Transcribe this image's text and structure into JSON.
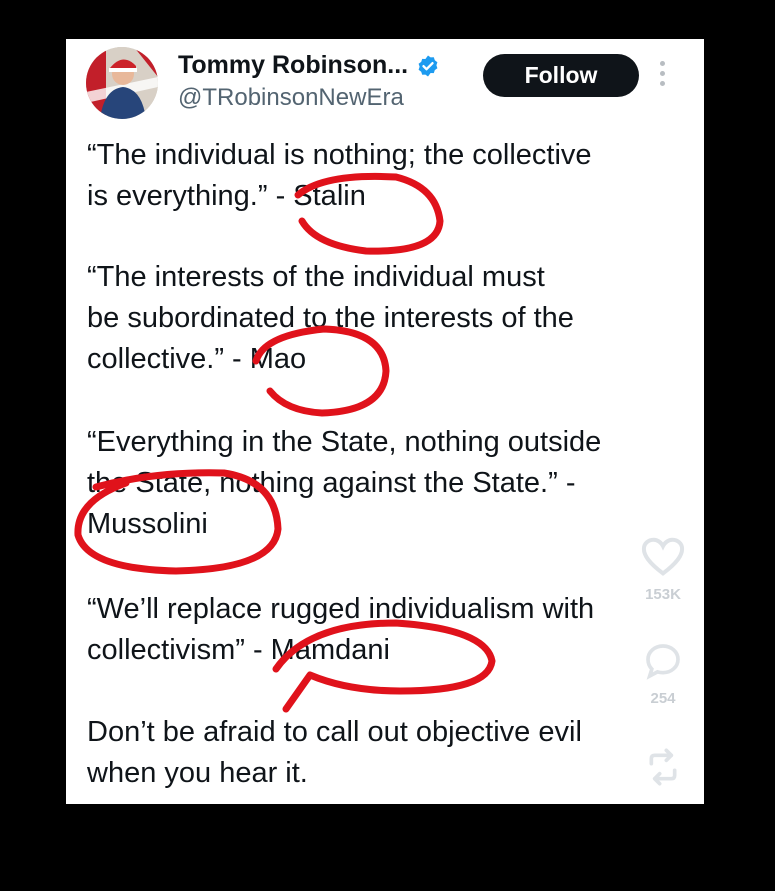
{
  "post": {
    "author_name": "Tommy Robinson...",
    "handle": "@TRobinsonNewEra",
    "follow_label": "Follow",
    "paragraphs": [
      "“The individual is nothing; the collective\nis everything.” - Stalin",
      "“The interests of the individual must\nbe subordinated to the interests of the\ncollective.” - Mao",
      "“Everything in the State, nothing outside\nthe State, nothing against the State.” -\nMussolini",
      "“We’ll replace rugged individualism with\ncollectivism” - Mamdani",
      "Don’t be afraid to call out objective evil\nwhen you hear it."
    ]
  },
  "actions": {
    "like_count": "153K",
    "comment_count": "254"
  },
  "colors": {
    "verified_badge": "#1d9bf0",
    "annotation_red": "#e0121b",
    "follow_button": "#0f1419"
  },
  "icons": [
    "verified-badge-icon",
    "more-options-icon",
    "heart-icon",
    "comment-icon",
    "share-icon"
  ]
}
